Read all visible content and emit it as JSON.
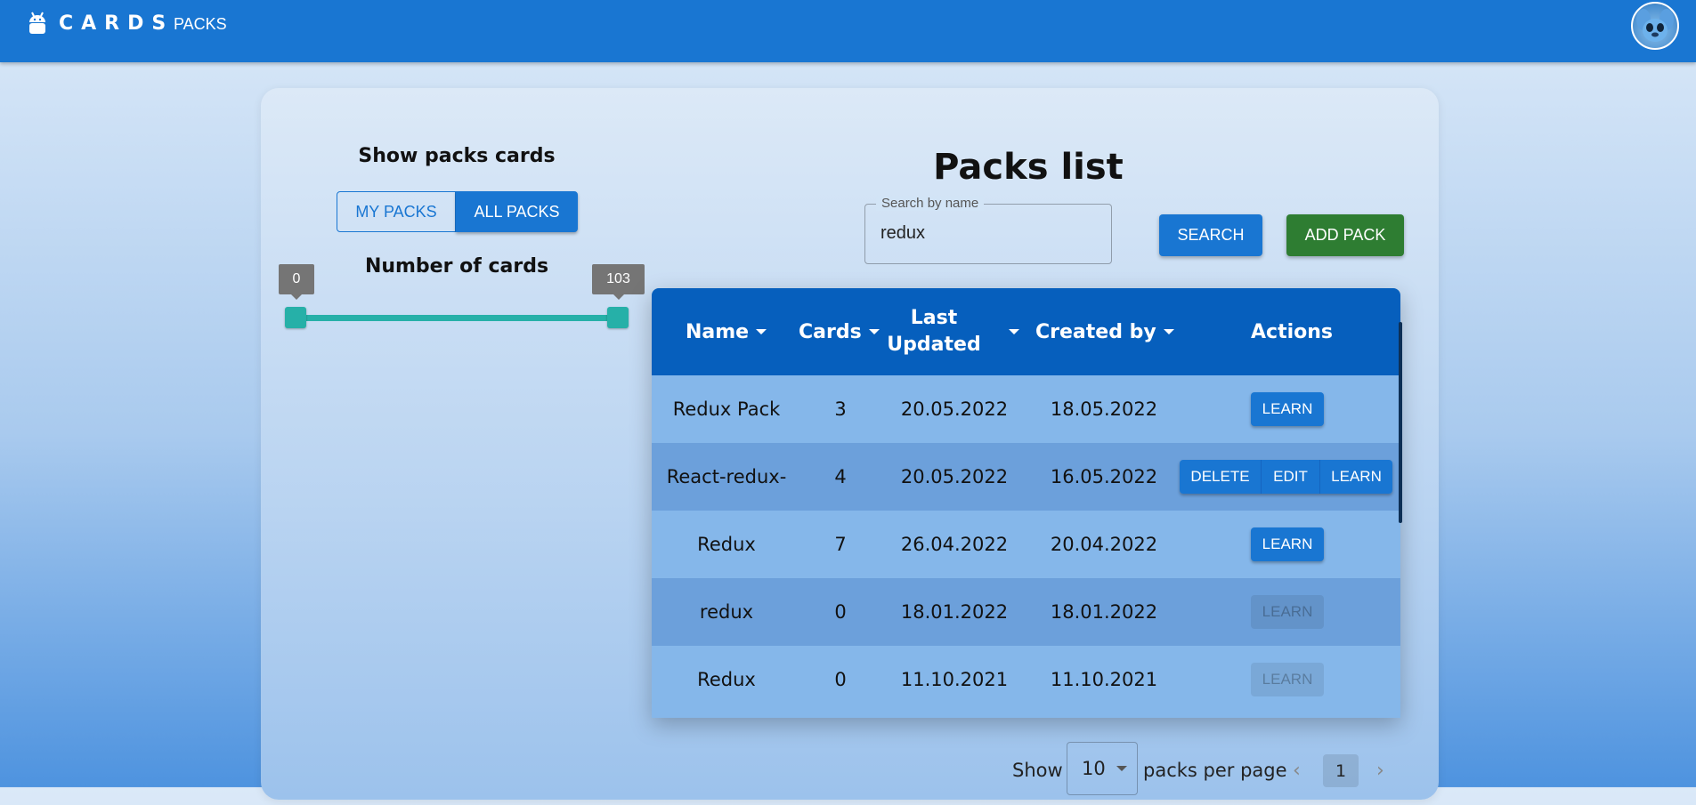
{
  "header": {
    "logo_text": "CARDS",
    "nav_packs": "PACKS"
  },
  "sidebar": {
    "show_title": "Show packs cards",
    "toggle": {
      "my": "MY PACKS",
      "all": "ALL PACKS",
      "selected": "ALL PACKS"
    },
    "number_title": "Number of cards",
    "slider": {
      "min": "0",
      "max": "103"
    }
  },
  "main": {
    "title": "Packs list",
    "search": {
      "label": "Search by name",
      "value": "redux"
    },
    "search_button": "SEARCH",
    "add_button": "ADD PACK"
  },
  "table": {
    "columns": [
      {
        "label": "Name"
      },
      {
        "label": "Cards"
      },
      {
        "label": "Last Updated"
      },
      {
        "label": "Created by"
      },
      {
        "label": "Actions"
      }
    ],
    "rows": [
      {
        "name": "Redux Pack",
        "cards": "3",
        "updated": "20.05.2022",
        "created": "18.05.2022",
        "learn": "LEARN"
      },
      {
        "name": "React-redux-",
        "cards": "4",
        "updated": "20.05.2022",
        "created": "16.05.2022",
        "delete": "DELETE",
        "edit": "EDIT",
        "learn": "LEARN"
      },
      {
        "name": "Redux",
        "cards": "7",
        "updated": "26.04.2022",
        "created": "20.04.2022",
        "learn": "LEARN"
      },
      {
        "name": "redux",
        "cards": "0",
        "updated": "18.01.2022",
        "created": "18.01.2022",
        "learn": "LEARN"
      },
      {
        "name": "Redux",
        "cards": "0",
        "updated": "11.10.2021",
        "created": "11.10.2021",
        "learn": "LEARN"
      }
    ]
  },
  "pagination": {
    "show_label": "Show",
    "per_page_value": "10",
    "per_page_label": "packs per page",
    "current_page": "1",
    "prev_icon": "chevron-left-icon",
    "next_icon": "chevron-right-icon"
  },
  "colors": {
    "primary": "#1976d2",
    "add": "#2e7d32",
    "table_header": "#065fbd",
    "slider": "#26b0a8"
  }
}
